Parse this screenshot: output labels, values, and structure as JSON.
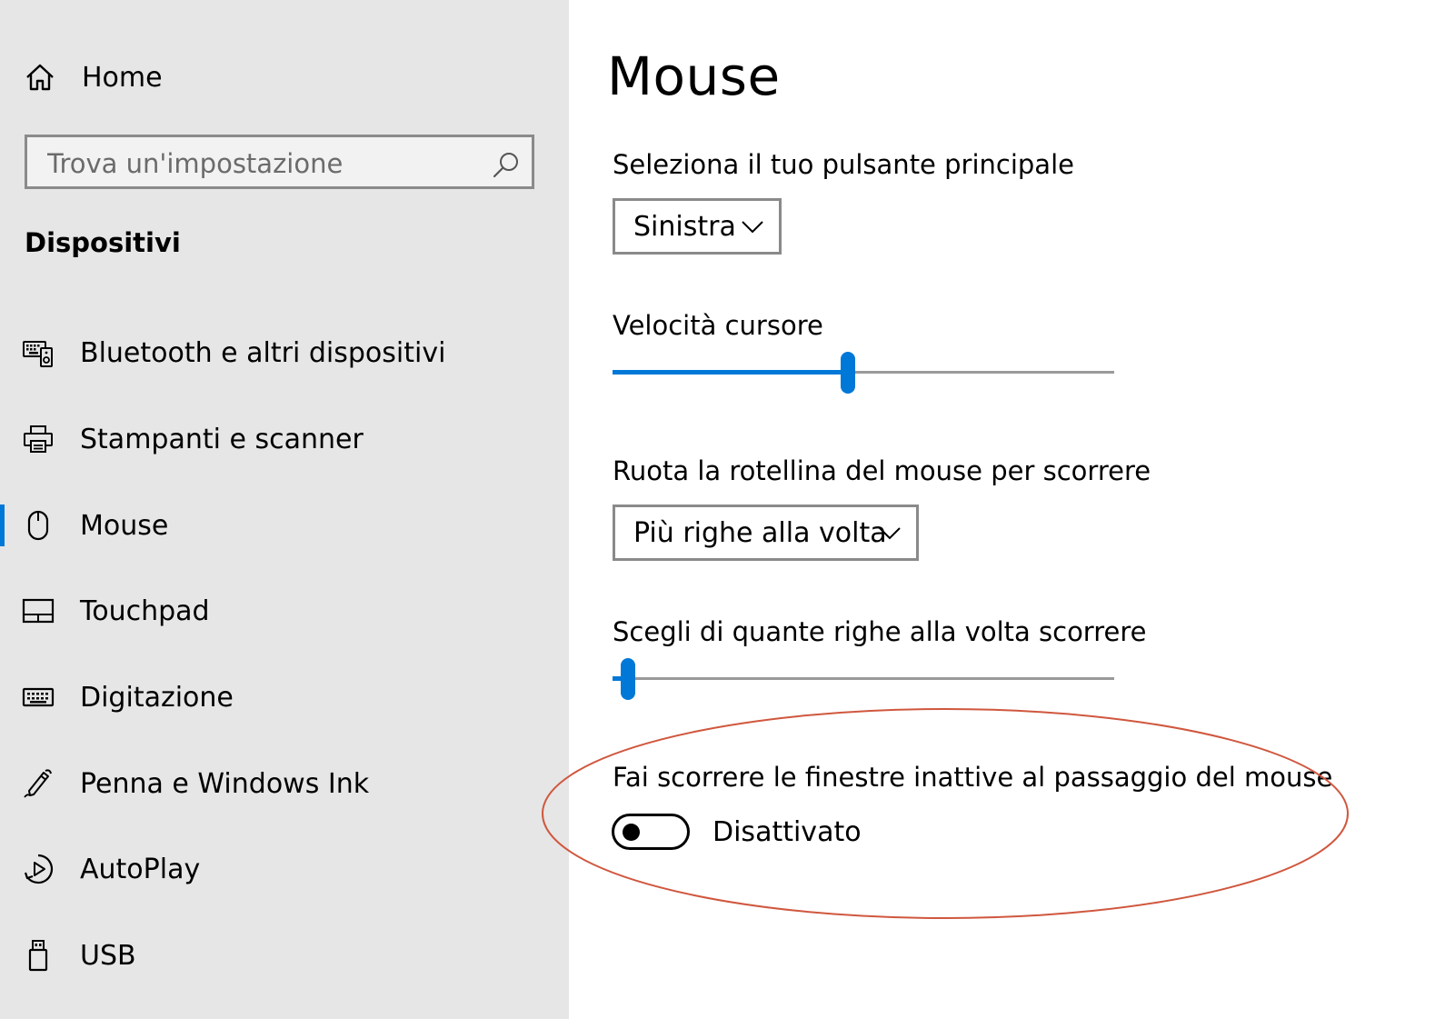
{
  "sidebar": {
    "home_label": "Home",
    "search_placeholder": "Trova un'impostazione",
    "section_title": "Dispositivi",
    "items": [
      {
        "label": "Bluetooth e altri dispositivi",
        "icon": "devices-icon"
      },
      {
        "label": "Stampanti e scanner",
        "icon": "printer-icon"
      },
      {
        "label": "Mouse",
        "icon": "mouse-icon",
        "active": true
      },
      {
        "label": "Touchpad",
        "icon": "touchpad-icon"
      },
      {
        "label": "Digitazione",
        "icon": "keyboard-icon"
      },
      {
        "label": "Penna e Windows Ink",
        "icon": "pen-icon"
      },
      {
        "label": "AutoPlay",
        "icon": "autoplay-icon"
      },
      {
        "label": "USB",
        "icon": "usb-icon"
      }
    ]
  },
  "main": {
    "title": "Mouse",
    "primary_button": {
      "label": "Seleziona il tuo pulsante principale",
      "value": "Sinistra"
    },
    "cursor_speed": {
      "label": "Velocità cursore",
      "value_fraction": 0.47
    },
    "scroll_wheel": {
      "label": "Ruota la rotellina del mouse per scorrere",
      "value": "Più righe alla volta"
    },
    "lines_to_scroll": {
      "label": "Scegli di quante righe alla volta scorrere",
      "value_fraction": 0.03
    },
    "inactive_scroll": {
      "label": "Fai scorrere le finestre inattive al passaggio del mouse",
      "state_label": "Disattivato",
      "enabled": false
    }
  },
  "colors": {
    "accent": "#0078d7",
    "sidebar_bg": "#e6e6e6",
    "annotation": "#d0573e"
  }
}
